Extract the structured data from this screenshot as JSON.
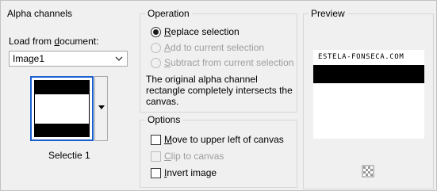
{
  "alpha_channels": {
    "group_title": "Alpha channels",
    "load_label_before": "Load from ",
    "load_label_underlined": "d",
    "load_label_after": "ocument:",
    "document_value": "Image1",
    "channel_name": "Selectie 1"
  },
  "operation": {
    "group_title": "Operation",
    "options": [
      {
        "underlined": "R",
        "rest": "eplace selection",
        "checked": true,
        "disabled": false
      },
      {
        "underlined": "A",
        "rest": "dd to current selection",
        "checked": false,
        "disabled": true
      },
      {
        "underlined": "S",
        "rest": "ubtract from current selection",
        "checked": false,
        "disabled": true
      }
    ],
    "message_line1": "The original alpha channel",
    "message_line2": "rectangle completely intersects the",
    "message_line3": "canvas."
  },
  "options": {
    "group_title": "Options",
    "items": [
      {
        "underlined": "M",
        "rest": "ove to upper left of canvas",
        "checked": false,
        "disabled": false
      },
      {
        "underlined": "C",
        "rest": "lip to canvas",
        "checked": false,
        "disabled": true
      },
      {
        "underlined": "I",
        "rest": "nvert image",
        "checked": false,
        "disabled": false
      }
    ]
  },
  "preview": {
    "group_title": "Preview",
    "watermark": "ESTELA-FONSECA.COM",
    "zoom_icon": "checkerboard-zoom-icon"
  },
  "colors": {
    "accent": "#1a5fd0",
    "disabled": "#9e9e9e"
  }
}
